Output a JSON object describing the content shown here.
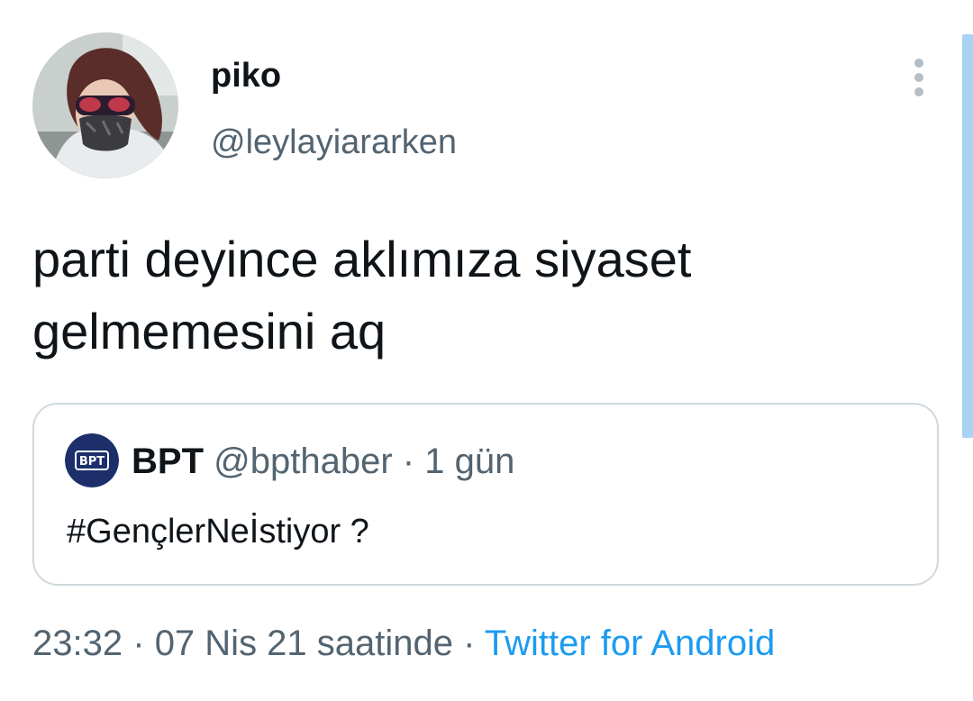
{
  "tweet": {
    "author": {
      "display_name": "piko",
      "handle": "@leylayiararken"
    },
    "text": "parti deyince aklımıza siyaset\ngelmemesini aq",
    "more_icon": "more-vertical-icon"
  },
  "quoted_tweet": {
    "author": {
      "display_name": "BPT",
      "handle": "@bpthaber",
      "avatar_label": "BPT"
    },
    "separator": "·",
    "time": "1 gün",
    "text": "#GençlerNeİstiyor ?"
  },
  "meta": {
    "time": "23:32",
    "separator": "·",
    "date": "07 Nis 21 saatinde",
    "source": "Twitter for Android"
  },
  "colors": {
    "text_primary": "#0f1419",
    "text_secondary": "#536471",
    "link": "#1d9bf0",
    "border": "#cfd9de",
    "scrollbar": "#a8d3f3"
  }
}
